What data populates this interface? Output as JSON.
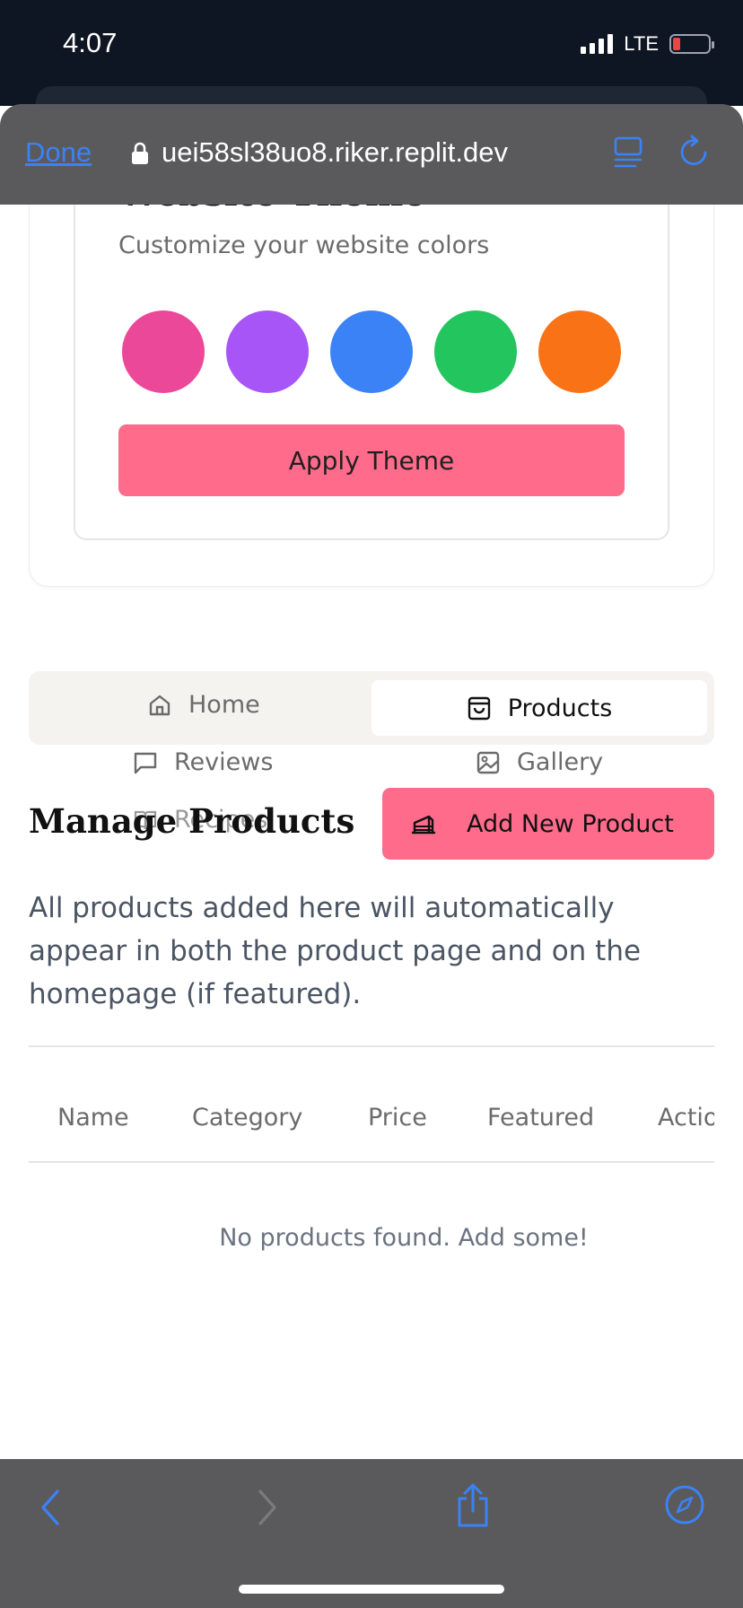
{
  "status_bar": {
    "time": "4:07",
    "network": "LTE"
  },
  "browser": {
    "done_label": "Done",
    "url": "uei58sl38uo8.riker.replit.dev"
  },
  "theme_card": {
    "title": "Website Theme",
    "subtitle": "Customize your website colors",
    "swatches": [
      "#ec4899",
      "#a855f7",
      "#3b82f6",
      "#22c55e",
      "#f97316"
    ],
    "apply_label": "Apply Theme"
  },
  "tabs": {
    "home": "Home",
    "products": "Products",
    "reviews": "Reviews",
    "gallery": "Gallery",
    "recipes": "Recipes"
  },
  "products": {
    "title": "Manage Products",
    "add_label": "Add New Product",
    "description": "All products added here will automatically appear in both the product page and on the homepage (if featured).",
    "columns": [
      "Name",
      "Category",
      "Price",
      "Featured",
      "Actions"
    ],
    "empty_message": "No products found. Add some!"
  },
  "colors": {
    "accent": "#ff6b8b",
    "link_blue": "#3b82f6",
    "browser_chrome": "#5a5a5c",
    "status_bg": "#0f1623"
  }
}
